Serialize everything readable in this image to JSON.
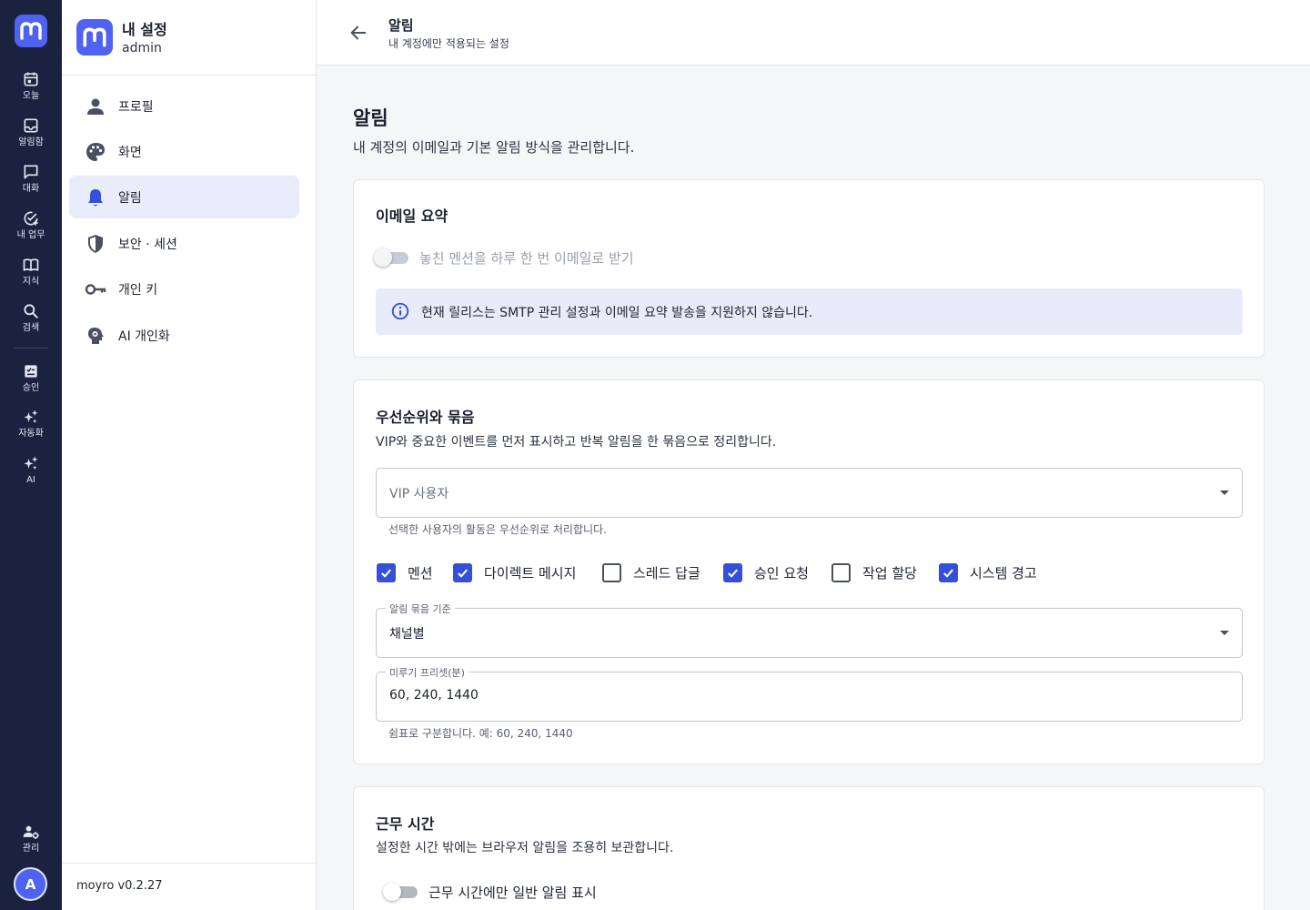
{
  "rail": {
    "items": [
      {
        "label": "오늘",
        "icon": "calendar-icon"
      },
      {
        "label": "알림함",
        "icon": "inbox-icon"
      },
      {
        "label": "대화",
        "icon": "chat-icon"
      },
      {
        "label": "내 업무",
        "icon": "task-check-icon"
      },
      {
        "label": "지식",
        "icon": "book-icon"
      },
      {
        "label": "검색",
        "icon": "search-icon"
      },
      {
        "label": "승인",
        "icon": "approval-icon"
      },
      {
        "label": "자동화",
        "icon": "sparkle-icon"
      },
      {
        "label": "AI",
        "icon": "ai-sparkle-icon"
      },
      {
        "label": "관리",
        "icon": "admin-icon"
      }
    ],
    "avatar_initial": "A"
  },
  "sidebar": {
    "title": "내 설정",
    "user": "admin",
    "items": [
      {
        "label": "프로필",
        "icon": "person-icon"
      },
      {
        "label": "화면",
        "icon": "palette-icon"
      },
      {
        "label": "알림",
        "icon": "bell-icon",
        "active": true
      },
      {
        "label": "보안 · 세션",
        "icon": "shield-icon"
      },
      {
        "label": "개인 키",
        "icon": "key-icon"
      },
      {
        "label": "AI 개인화",
        "icon": "ai-gear-icon"
      }
    ],
    "version": "moyro v0.2.27"
  },
  "topbar": {
    "title": "알림",
    "subtitle": "내 계정에만 적용되는 설정"
  },
  "page": {
    "title": "알림",
    "description": "내 계정의 이메일과 기본 알림 방식을 관리합니다."
  },
  "email_card": {
    "title": "이메일 요약",
    "toggle_label": "놓친 멘션을 하루 한 번 이메일로 받기",
    "toggle_on": false,
    "info": "현재 릴리스는 SMTP 관리 설정과 이메일 요약 발송을 지원하지 않습니다."
  },
  "priority_card": {
    "title": "우선순위와 묶음",
    "description": "VIP와 중요한 이벤트를 먼저 표시하고 반복 알림을 한 묶음으로 정리합니다.",
    "vip_placeholder": "VIP 사용자",
    "vip_helper": "선택한 사용자의 활동은 우선순위로 처리합니다.",
    "checkboxes": [
      {
        "label": "멘션",
        "checked": true
      },
      {
        "label": "다이렉트 메시지",
        "checked": true
      },
      {
        "label": "스레드 답글",
        "checked": false
      },
      {
        "label": "승인 요청",
        "checked": true
      },
      {
        "label": "작업 할당",
        "checked": false
      },
      {
        "label": "시스템 경고",
        "checked": true
      }
    ],
    "group_label": "알림 묶음 기준",
    "group_value": "채널별",
    "snooze_label": "미루기 프리셋(분)",
    "snooze_value": "60, 240, 1440",
    "snooze_helper": "쉼표로 구분합니다. 예: 60, 240, 1440"
  },
  "work_card": {
    "title": "근무 시간",
    "description": "설정한 시간 밖에는 브라우저 알림을 조용히 보관합니다.",
    "toggle_label": "근무 시간에만 일반 알림 표시",
    "toggle_on": false
  },
  "colors": {
    "rail_bg": "#1b2240",
    "accent": "#4f63f0",
    "checkbox_on": "#3450d8",
    "active_nav_bg": "#e9ecfb",
    "info_bg": "#e8ebf9"
  }
}
